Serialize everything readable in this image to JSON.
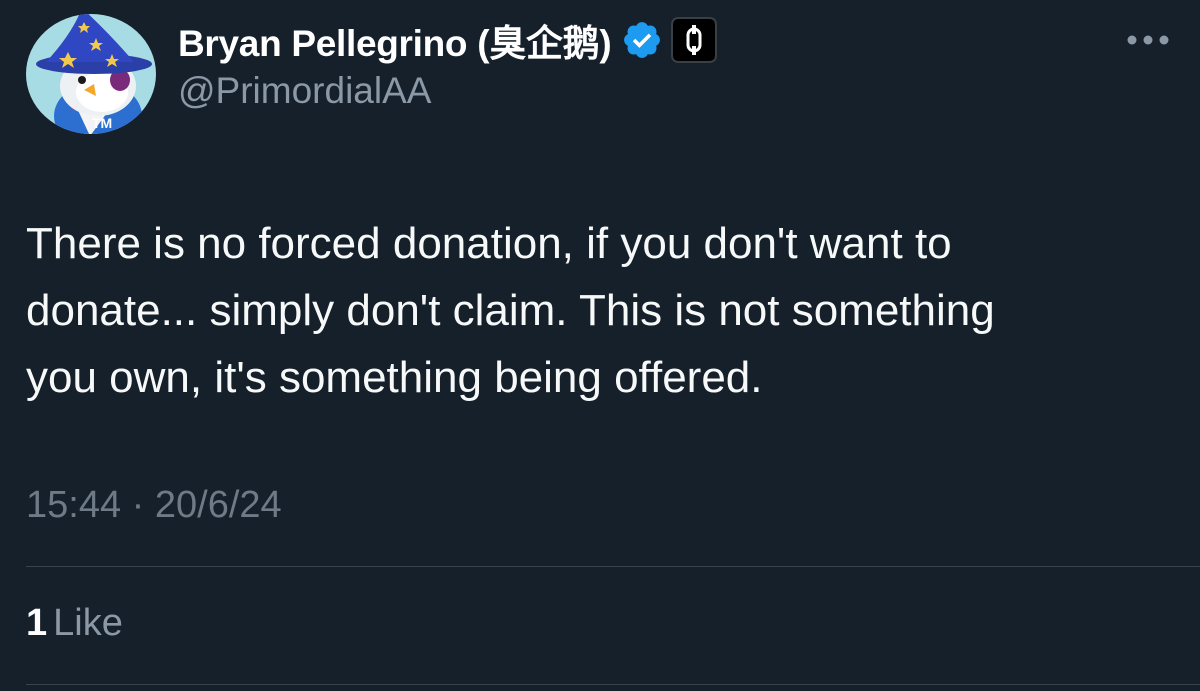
{
  "tweet": {
    "author": {
      "display_name": "Bryan Pellegrino (臭企鹅)",
      "handle": "@PrimordialAA",
      "verified": true,
      "avatar_icon": "penguin-wizard-avatar",
      "affiliate_badge_icon": "layerzero-badge-icon"
    },
    "more_icon": "more-horizontal-icon",
    "text": "There is no forced donation, if you don't want to\ndonate... simply don't claim. This is not something\nyou own, it's something being offered.",
    "time": "15:44",
    "separator": "·",
    "date": "20/6/24",
    "likes": {
      "count": "1",
      "label": "Like"
    },
    "colors": {
      "background": "#15202b",
      "verified_blue": "#1d9bf0",
      "secondary_text": "#8b98a5"
    }
  }
}
